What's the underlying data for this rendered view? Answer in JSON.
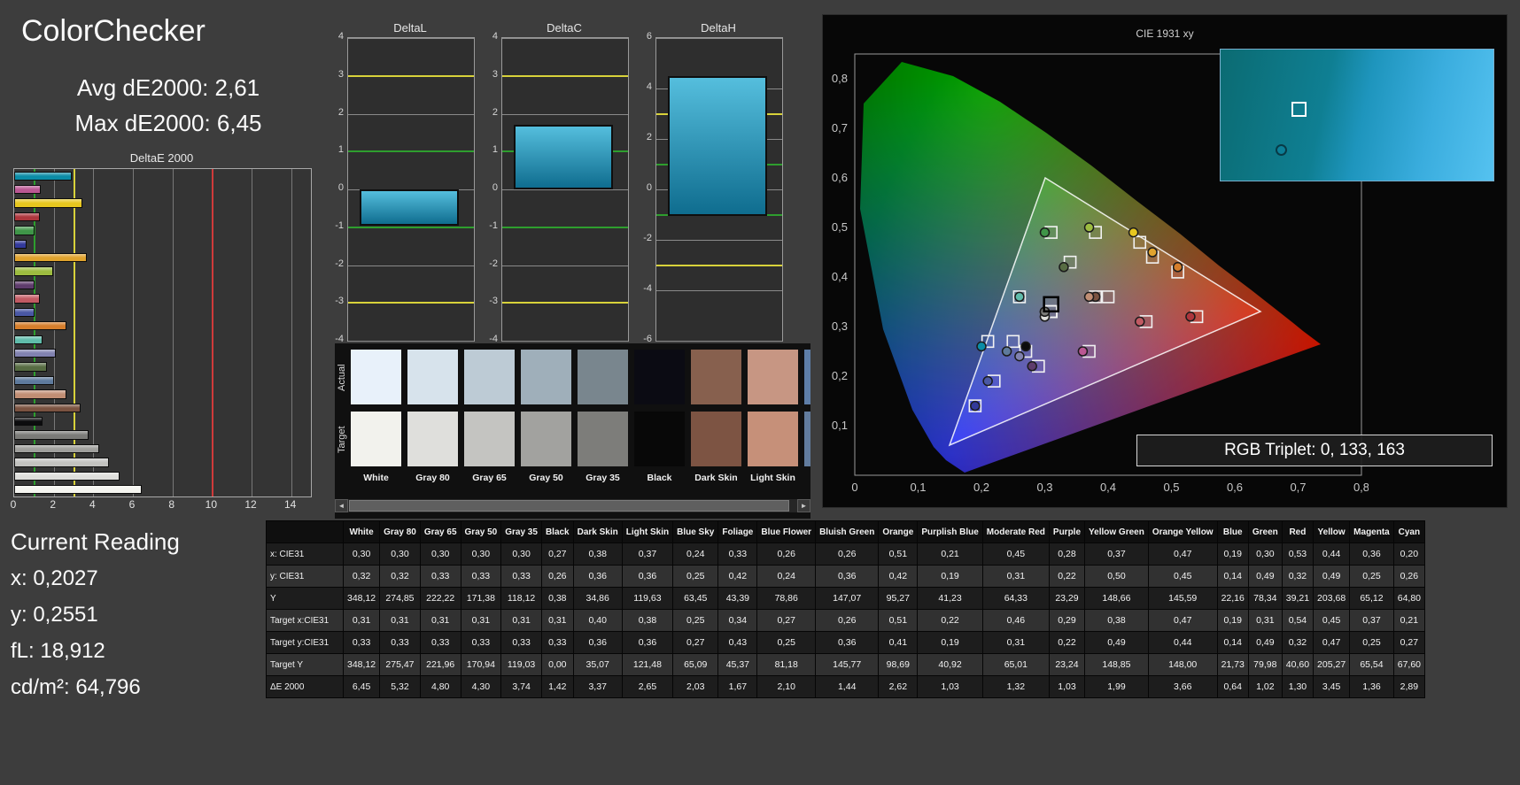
{
  "app": {
    "title": "ColorChecker",
    "avg_label": "Avg dE2000: 2,61",
    "max_label": "Max dE2000: 6,45"
  },
  "current_reading": {
    "title": "Current Reading",
    "x": "x: 0,2027",
    "y": "y: 0,2551",
    "fl": "fL: 18,912",
    "cd": "cd/m²: 64,796"
  },
  "cie": {
    "title": "CIE 1931 xy",
    "rgb_triplet": "RGB Triplet: 0, 133, 163",
    "x_ticks": [
      "0",
      "0,1",
      "0,2",
      "0,3",
      "0,4",
      "0,5",
      "0,6",
      "0,7",
      "0,8"
    ],
    "y_ticks": [
      "0,1",
      "0,2",
      "0,3",
      "0,4",
      "0,5",
      "0,6",
      "0,7",
      "0,8"
    ]
  },
  "swatch_strip": {
    "row_labels": [
      "Actual",
      "Target"
    ],
    "visible_count": 9,
    "scroll_left": "◄",
    "scroll_right": "►"
  },
  "table": {
    "row_labels": [
      "x: CIE31",
      "y: CIE31",
      "Y",
      "Target x:CIE31",
      "Target y:CIE31",
      "Target Y",
      "ΔE 2000"
    ],
    "row_keys": [
      "x",
      "y",
      "Y",
      "tx",
      "ty",
      "tY",
      "dE"
    ]
  },
  "chart_data": [
    {
      "type": "bar",
      "title": "DeltaE 2000",
      "orientation": "horizontal",
      "xlim": [
        0,
        15
      ],
      "x_ticks": [
        0,
        2,
        4,
        6,
        8,
        10,
        12,
        14
      ],
      "ref_lines": {
        "green": 1,
        "yellow": 3,
        "red": 10
      },
      "categories": [
        "Cyan",
        "Magenta",
        "Yellow",
        "Red",
        "Green",
        "Blue",
        "Orange Yellow",
        "Yellow Green",
        "Purple",
        "Moderate Red",
        "Purplish Blue",
        "Orange",
        "Bluish Green",
        "Blue Flower",
        "Foliage",
        "Blue Sky",
        "Light Skin",
        "Dark Skin",
        "Black",
        "Gray 35",
        "Gray 50",
        "Gray 65",
        "Gray 80",
        "White"
      ],
      "values": [
        2.89,
        1.36,
        3.45,
        1.3,
        1.02,
        0.64,
        3.66,
        1.99,
        1.03,
        1.32,
        1.03,
        2.62,
        1.44,
        2.1,
        1.67,
        2.03,
        2.65,
        3.37,
        1.42,
        3.74,
        4.3,
        4.8,
        5.32,
        6.45
      ]
    },
    {
      "type": "bar",
      "title": "DeltaL",
      "ylim": [
        -4,
        4
      ],
      "tick_step": 1,
      "bar": [
        0,
        -0.95
      ],
      "ref_lines": {
        "yellow": [
          3,
          -3
        ],
        "green": [
          1,
          -1
        ]
      }
    },
    {
      "type": "bar",
      "title": "DeltaC",
      "ylim": [
        -4,
        4
      ],
      "tick_step": 1,
      "bar": [
        0,
        1.7
      ],
      "ref_lines": {
        "yellow": [
          3,
          -3
        ],
        "green": [
          1,
          -1
        ]
      }
    },
    {
      "type": "bar",
      "title": "DeltaH",
      "ylim": [
        -6,
        6
      ],
      "tick_step": 2,
      "bar": [
        -1.05,
        4.5
      ],
      "ref_lines": {
        "yellow": [
          3,
          -3
        ],
        "green": [
          1,
          -1
        ]
      }
    },
    {
      "type": "scatter",
      "title": "CIE 1931 xy",
      "xlim": [
        0,
        0.8
      ],
      "ylim": [
        0,
        0.85
      ],
      "points_source": "patches (measured x/y as circles, target tx/ty as squares)",
      "highlight": [
        0.31,
        0.345
      ]
    }
  ],
  "patches": [
    {
      "name": "White",
      "x": "0,30",
      "y": "0,32",
      "Y": "348,12",
      "tx": "0,31",
      "ty": "0,33",
      "tY": "348,12",
      "dE": "6,45",
      "color": "#f4f4ef",
      "actual": "#e8f1fa",
      "target": "#f2f2ed"
    },
    {
      "name": "Gray 80",
      "x": "0,30",
      "y": "0,32",
      "Y": "274,85",
      "tx": "0,31",
      "ty": "0,33",
      "tY": "275,47",
      "dE": "5,32",
      "color": "#dededb",
      "actual": "#d7e3ec",
      "target": "#dfdfdc"
    },
    {
      "name": "Gray 65",
      "x": "0,30",
      "y": "0,33",
      "Y": "222,22",
      "tx": "0,31",
      "ty": "0,33",
      "tY": "221,96",
      "dE": "4,80",
      "color": "#c2c2bf",
      "actual": "#bdcbd5",
      "target": "#c4c4c1"
    },
    {
      "name": "Gray 50",
      "x": "0,30",
      "y": "0,33",
      "Y": "171,38",
      "tx": "0,31",
      "ty": "0,33",
      "tY": "170,94",
      "dE": "4,30",
      "color": "#a0a09d",
      "actual": "#9fafba",
      "target": "#a2a29f"
    },
    {
      "name": "Gray 35",
      "x": "0,30",
      "y": "0,33",
      "Y": "118,12",
      "tx": "0,31",
      "ty": "0,33",
      "tY": "119,03",
      "dE": "3,74",
      "color": "#7b7b78",
      "actual": "#79868e",
      "target": "#7d7d7a"
    },
    {
      "name": "Black",
      "x": "0,27",
      "y": "0,26",
      "Y": "0,38",
      "tx": "0,31",
      "ty": "0,33",
      "tY": "0,00",
      "dE": "1,42",
      "color": "#0c0c0e",
      "actual": "#0b0b13",
      "target": "#080808"
    },
    {
      "name": "Dark Skin",
      "x": "0,38",
      "y": "0,36",
      "Y": "34,86",
      "tx": "0,40",
      "ty": "0,36",
      "tY": "35,07",
      "dE": "3,37",
      "color": "#7b5341",
      "actual": "#87604e",
      "target": "#7d5443"
    },
    {
      "name": "Light Skin",
      "x": "0,37",
      "y": "0,36",
      "Y": "119,63",
      "tx": "0,38",
      "ty": "0,36",
      "tY": "121,48",
      "dE": "2,65",
      "color": "#c18e74",
      "actual": "#c79683",
      "target": "#c69079"
    },
    {
      "name": "Blue Sky",
      "x": "0,24",
      "y": "0,25",
      "Y": "63,45",
      "tx": "0,25",
      "ty": "0,27",
      "tY": "65,09",
      "dE": "2,03",
      "color": "#5e7a9c",
      "actual": "#5e7ea8",
      "target": "#627c9e"
    },
    {
      "name": "Foliage",
      "x": "0,33",
      "y": "0,42",
      "Y": "43,39",
      "tx": "0,34",
      "ty": "0,43",
      "tY": "45,37",
      "dE": "1,67",
      "color": "#576c43",
      "actual": "#5a6e45",
      "target": "#576c43"
    },
    {
      "name": "Blue Flower",
      "x": "0,26",
      "y": "0,24",
      "Y": "78,86",
      "tx": "0,27",
      "ty": "0,25",
      "tY": "81,18",
      "dE": "2,10",
      "color": "#8182b0",
      "actual": "#8384b4",
      "target": "#8180ae"
    },
    {
      "name": "Bluish Green",
      "x": "0,26",
      "y": "0,36",
      "Y": "147,07",
      "tx": "0,26",
      "ty": "0,36",
      "tY": "145,77",
      "dE": "1,44",
      "color": "#60bcab",
      "actual": "#62bfae",
      "target": "#5fbaa9"
    },
    {
      "name": "Orange",
      "x": "0,51",
      "y": "0,42",
      "Y": "95,27",
      "tx": "0,51",
      "ty": "0,41",
      "tY": "98,69",
      "dE": "2,62",
      "color": "#d67e2c",
      "actual": "#d8812f",
      "target": "#d47d2a"
    },
    {
      "name": "Purplish Blue",
      "x": "0,21",
      "y": "0,19",
      "Y": "41,23",
      "tx": "0,22",
      "ty": "0,19",
      "tY": "40,92",
      "dE": "1,03",
      "color": "#4a58a5",
      "actual": "#4c5aa8",
      "target": "#4957a3"
    },
    {
      "name": "Moderate Red",
      "x": "0,45",
      "y": "0,31",
      "Y": "64,33",
      "tx": "0,46",
      "ty": "0,31",
      "tY": "65,01",
      "dE": "1,32",
      "color": "#c15a63",
      "actual": "#c35d66",
      "target": "#bf5861"
    },
    {
      "name": "Purple",
      "x": "0,28",
      "y": "0,22",
      "Y": "23,29",
      "tx": "0,29",
      "ty": "0,22",
      "tY": "23,24",
      "dE": "1,03",
      "color": "#5e3c6c",
      "actual": "#603e6e",
      "target": "#5c3a6a"
    },
    {
      "name": "Yellow Green",
      "x": "0,37",
      "y": "0,50",
      "Y": "148,66",
      "tx": "0,38",
      "ty": "0,49",
      "tY": "148,85",
      "dE": "1,99",
      "color": "#9dbc40",
      "actual": "#9fbe43",
      "target": "#9bba3e"
    },
    {
      "name": "Orange Yellow",
      "x": "0,47",
      "y": "0,45",
      "Y": "145,59",
      "tx": "0,47",
      "ty": "0,44",
      "tY": "148,00",
      "dE": "3,66",
      "color": "#e0a32e",
      "actual": "#e2a531",
      "target": "#dea12c"
    },
    {
      "name": "Blue",
      "x": "0,19",
      "y": "0,14",
      "Y": "22,16",
      "tx": "0,19",
      "ty": "0,14",
      "tY": "21,73",
      "dE": "0,64",
      "color": "#32399b",
      "actual": "#343b9e",
      "target": "#303798"
    },
    {
      "name": "Green",
      "x": "0,30",
      "y": "0,49",
      "Y": "78,34",
      "tx": "0,31",
      "ty": "0,49",
      "tY": "79,98",
      "dE": "1,02",
      "color": "#3f9548",
      "actual": "#41984b",
      "target": "#3d9346"
    },
    {
      "name": "Red",
      "x": "0,53",
      "y": "0,32",
      "Y": "39,21",
      "tx": "0,54",
      "ty": "0,32",
      "tY": "40,60",
      "dE": "1,30",
      "color": "#ad363d",
      "actual": "#af383f",
      "target": "#ab343b"
    },
    {
      "name": "Yellow",
      "x": "0,44",
      "y": "0,49",
      "Y": "203,68",
      "tx": "0,45",
      "ty": "0,47",
      "tY": "205,27",
      "dE": "3,45",
      "color": "#e7c71f",
      "actual": "#e9c922",
      "target": "#e5c51d"
    },
    {
      "name": "Magenta",
      "x": "0,36",
      "y": "0,25",
      "Y": "65,12",
      "tx": "0,37",
      "ty": "0,25",
      "tY": "65,54",
      "dE": "1,36",
      "color": "#ba5793",
      "actual": "#bc5996",
      "target": "#b85590"
    },
    {
      "name": "Cyan",
      "x": "0,20",
      "y": "0,26",
      "Y": "64,80",
      "tx": "0,21",
      "ty": "0,27",
      "tY": "67,60",
      "dE": "2,89",
      "color": "#0b8ca6",
      "actual": "#0d8ea9",
      "target": "#098aa3"
    }
  ]
}
